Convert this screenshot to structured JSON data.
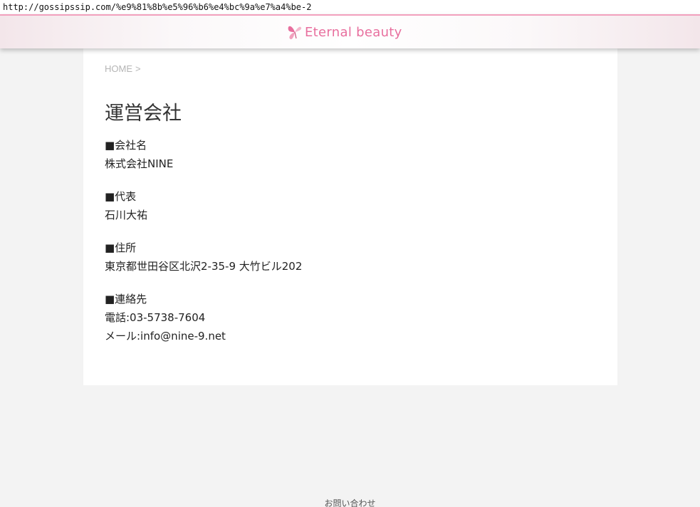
{
  "browser": {
    "url": "http://gossipssip.com/%e9%81%8b%e5%96%b6%e4%bc%9a%e7%a4%be-2"
  },
  "header": {
    "logo_text": "Eternal beauty",
    "logo_icon": "butterfly-icon",
    "accent_color": "#e86f9e"
  },
  "breadcrumb": {
    "home": "HOME",
    "separator": ">"
  },
  "page": {
    "title": "運営会社",
    "sections": [
      {
        "heading": "■会社名",
        "lines": [
          "株式会社NINE"
        ]
      },
      {
        "heading": "■代表",
        "lines": [
          "石川大祐"
        ]
      },
      {
        "heading": "■住所",
        "lines": [
          "東京都世田谷区北沢2-35-9 大竹ビル202"
        ]
      },
      {
        "heading": "■連絡先",
        "lines": [
          "電話:03-5738-7604",
          "メール:info@nine-9.net"
        ]
      }
    ]
  },
  "footer": {
    "contact_link": "お問い合わせ"
  }
}
